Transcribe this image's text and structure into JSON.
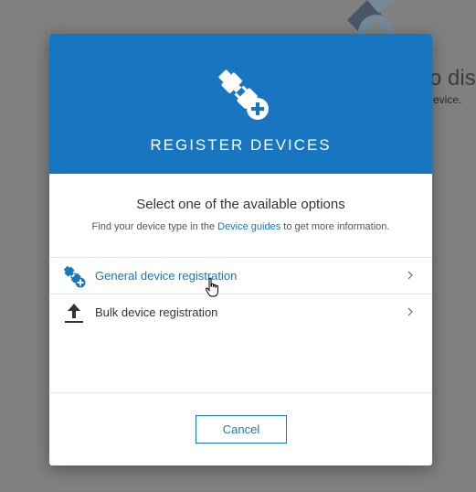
{
  "background": {
    "title_fragment": "o dis",
    "subtitle_fragment": "evice."
  },
  "modal": {
    "title": "REGISTER DEVICES",
    "header_icon": "plug-add-icon",
    "intro_title": "Select one of the available options",
    "intro_text_before": "Find your device type in the ",
    "intro_link": "Device guides",
    "intro_text_after": " to get more information.",
    "options": [
      {
        "label": "General device registration",
        "icon": "plug-add-icon",
        "state": "hover"
      },
      {
        "label": "Bulk device registration",
        "icon": "upload-icon",
        "state": "normal"
      }
    ],
    "cancel_label": "Cancel"
  },
  "colors": {
    "primary": "#1776bf",
    "overlay": "#808080",
    "text_dark": "#333333"
  }
}
